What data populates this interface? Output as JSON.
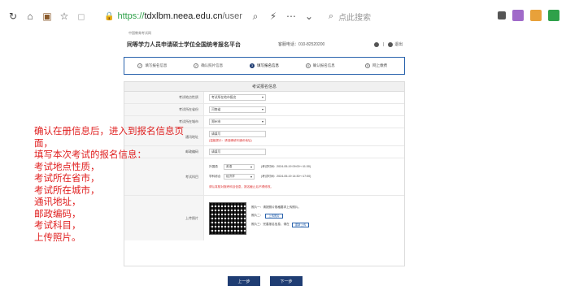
{
  "browser": {
    "url_scheme": "https://",
    "url_host": "tdxlbm.neea.edu.cn",
    "url_path": "/user",
    "search_placeholder": "点此搜索",
    "ext_colors": [
      "#555555",
      "#a06ac9",
      "#e8a13a",
      "#2fa14a"
    ]
  },
  "page": {
    "tiny_header": "中国教育考试网",
    "title": "同等学力人员申请硕士学位全国统考报名平台",
    "phone": "客服电话：010-82520200",
    "user_text": "退出"
  },
  "steps": [
    {
      "label": "填写报名信息",
      "icon": "✓"
    },
    {
      "label": "确认照片信息",
      "icon": "✓"
    },
    {
      "label": "填写报名信息",
      "icon": "3"
    },
    {
      "label": "确认报名信息",
      "icon": "4"
    },
    {
      "label": "网上缴费",
      "icon": "5"
    }
  ],
  "form": {
    "header": "考试报名信息",
    "rows": [
      {
        "label": "考试地点性质",
        "value": "考试所在地市报名"
      },
      {
        "label": "考试所在省份",
        "value": "河南省"
      },
      {
        "label": "考试所在城市",
        "value": "郑州市"
      },
      {
        "label": "通讯地址",
        "value": "请填写",
        "note": "(温馨提示：请准确填写通讯地址)"
      },
      {
        "label": "邮政编码",
        "value": "请填写"
      }
    ],
    "exam_label": "考试科目",
    "exams": [
      {
        "name": "外国语",
        "select": "英语",
        "time": "(考试时间：2024-05-19 09:00～11:30)"
      },
      {
        "name": "学科综合",
        "select": "经济学",
        "time": "(考试时间：2024-05-19 14:30～17:00)"
      }
    ],
    "exam_note": "请认真核对报考科目信息，报名截止后不得修改。",
    "photo_label": "上传照片",
    "photo_lines": [
      "照片一：请按照片规格要求上传照片。",
      "照片二：",
      "照片三：完善报名信息，请在"
    ],
    "photo_btn1": "上传照片",
    "photo_btn2": "重新上传"
  },
  "buttons": {
    "prev": "上一步",
    "next": "下一步"
  },
  "annotation": [
    "确认在册信息后，进入到报名信息页面，",
    "填写本次考试的报名信息：",
    "考试地点性质，",
    "考试所在省市，",
    "考试所在城市，",
    "通讯地址，",
    "邮政编码，",
    "考试科目，",
    "上传照片。"
  ]
}
